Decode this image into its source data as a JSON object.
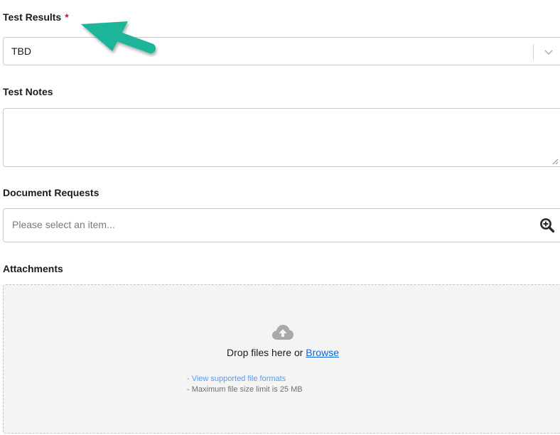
{
  "test_results": {
    "label": "Test Results",
    "required_mark": "*",
    "selected_value": "TBD",
    "chevron_icon": "chevron-down-icon"
  },
  "test_notes": {
    "label": "Test Notes",
    "value": ""
  },
  "document_requests": {
    "label": "Document Requests",
    "placeholder": "Please select an item...",
    "lookup_icon": "zoom-in-icon"
  },
  "attachments": {
    "label": "Attachments",
    "upload_icon": "cloud-upload-icon",
    "drop_text": "Drop files here or",
    "browse_label": "Browse",
    "formats_link": "- View supported file formats",
    "size_limit": "- Maximum file size limit is 25 MB"
  },
  "colors": {
    "required": "#c8102e",
    "link": "#0b66d9",
    "secondary_link": "#5b9be8",
    "annotation_arrow": "#1fb59a",
    "dropzone_bg": "#f4f4f4",
    "border": "#c9c9c9"
  }
}
